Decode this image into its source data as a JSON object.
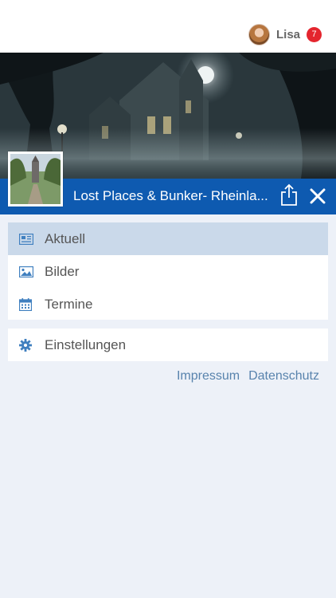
{
  "user": {
    "name": "Lisa",
    "notification_count": "7"
  },
  "group": {
    "title": "Lost Places & Bunker- Rheinla..."
  },
  "menu": {
    "items": [
      {
        "label": "Aktuell",
        "icon": "newspaper-icon",
        "active": true
      },
      {
        "label": "Bilder",
        "icon": "image-icon",
        "active": false
      },
      {
        "label": "Termine",
        "icon": "calendar-icon",
        "active": false
      }
    ],
    "settings": {
      "label": "Einstellungen",
      "icon": "gear-icon"
    }
  },
  "footer": {
    "impressum": "Impressum",
    "datenschutz": "Datenschutz"
  },
  "colors": {
    "accent": "#0e5ab0",
    "active_row": "#cad9ea",
    "badge": "#e4252e",
    "link": "#5883ad",
    "background": "#edf1f8"
  }
}
